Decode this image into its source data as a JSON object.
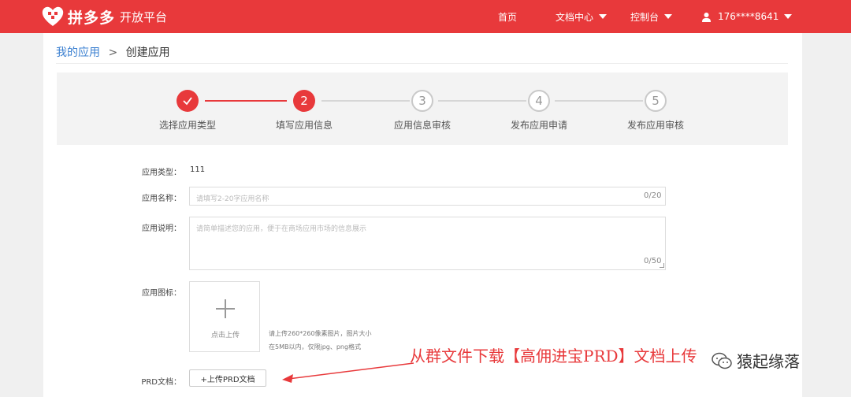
{
  "header": {
    "brand": "拼多多",
    "brand_sub": "开放平台",
    "nav": [
      {
        "label": "首页"
      },
      {
        "label": "文档中心"
      },
      {
        "label": "控制台"
      }
    ],
    "user": "176****8641",
    "color": "#e8393b"
  },
  "breadcrumb": {
    "parent": "我的应用",
    "separator": ">",
    "current": "创建应用"
  },
  "steps": [
    {
      "num": "1",
      "label": "选择应用类型",
      "state": "done"
    },
    {
      "num": "2",
      "label": "填写应用信息",
      "state": "active"
    },
    {
      "num": "3",
      "label": "应用信息审核",
      "state": "todo"
    },
    {
      "num": "4",
      "label": "发布应用申请",
      "state": "todo"
    },
    {
      "num": "5",
      "label": "发布应用审核",
      "state": "todo"
    }
  ],
  "form": {
    "type_label": "应用类型：",
    "type_value": "111",
    "name_label": "应用名称：",
    "name_placeholder": "请填写2-20字应用名称",
    "name_counter": "0/20",
    "desc_label": "应用说明：",
    "desc_placeholder": "请简单描述您的应用，便于在商场应用市场的信息展示",
    "desc_counter": "0/50",
    "icon_label": "应用图标：",
    "upload_text": "点击上传",
    "hint_line1": "请上传260*260像素图片，图片大小",
    "hint_line2": "在5MB以内，仅限jpg、png格式",
    "prd_label": "PRD文档：",
    "prd_button": "+上传PRD文档"
  },
  "annotation": "从群文件下载【高佣进宝PRD】文档上传",
  "watermark": "猿起缘落"
}
